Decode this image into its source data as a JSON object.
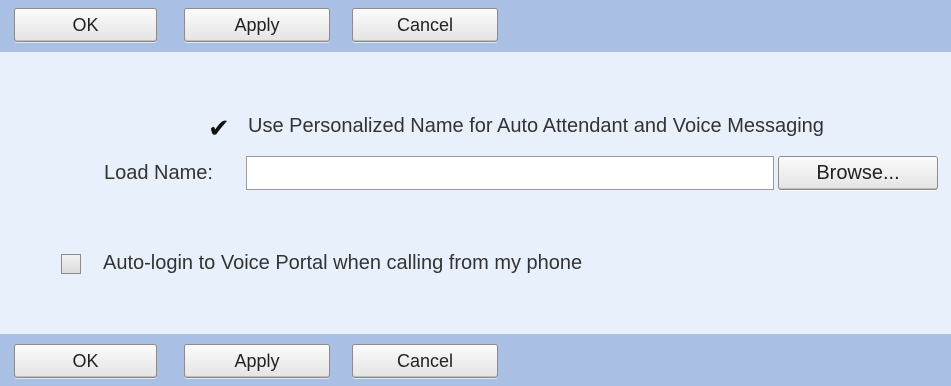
{
  "toolbar_top": {
    "ok_label": "OK",
    "apply_label": "Apply",
    "cancel_label": "Cancel"
  },
  "toolbar_bottom": {
    "ok_label": "OK",
    "apply_label": "Apply",
    "cancel_label": "Cancel"
  },
  "form": {
    "personalized_name_checked": true,
    "personalized_name_label": "Use Personalized Name for Auto Attendant and Voice Messaging",
    "load_name_label": "Load Name:",
    "load_name_value": "",
    "browse_label": "Browse...",
    "auto_login_checked": false,
    "auto_login_label": "Auto-login to Voice Portal when calling from my phone"
  },
  "colors": {
    "toolbar_bg": "#a9bfe3",
    "panel_bg": "#e7f0fb"
  }
}
